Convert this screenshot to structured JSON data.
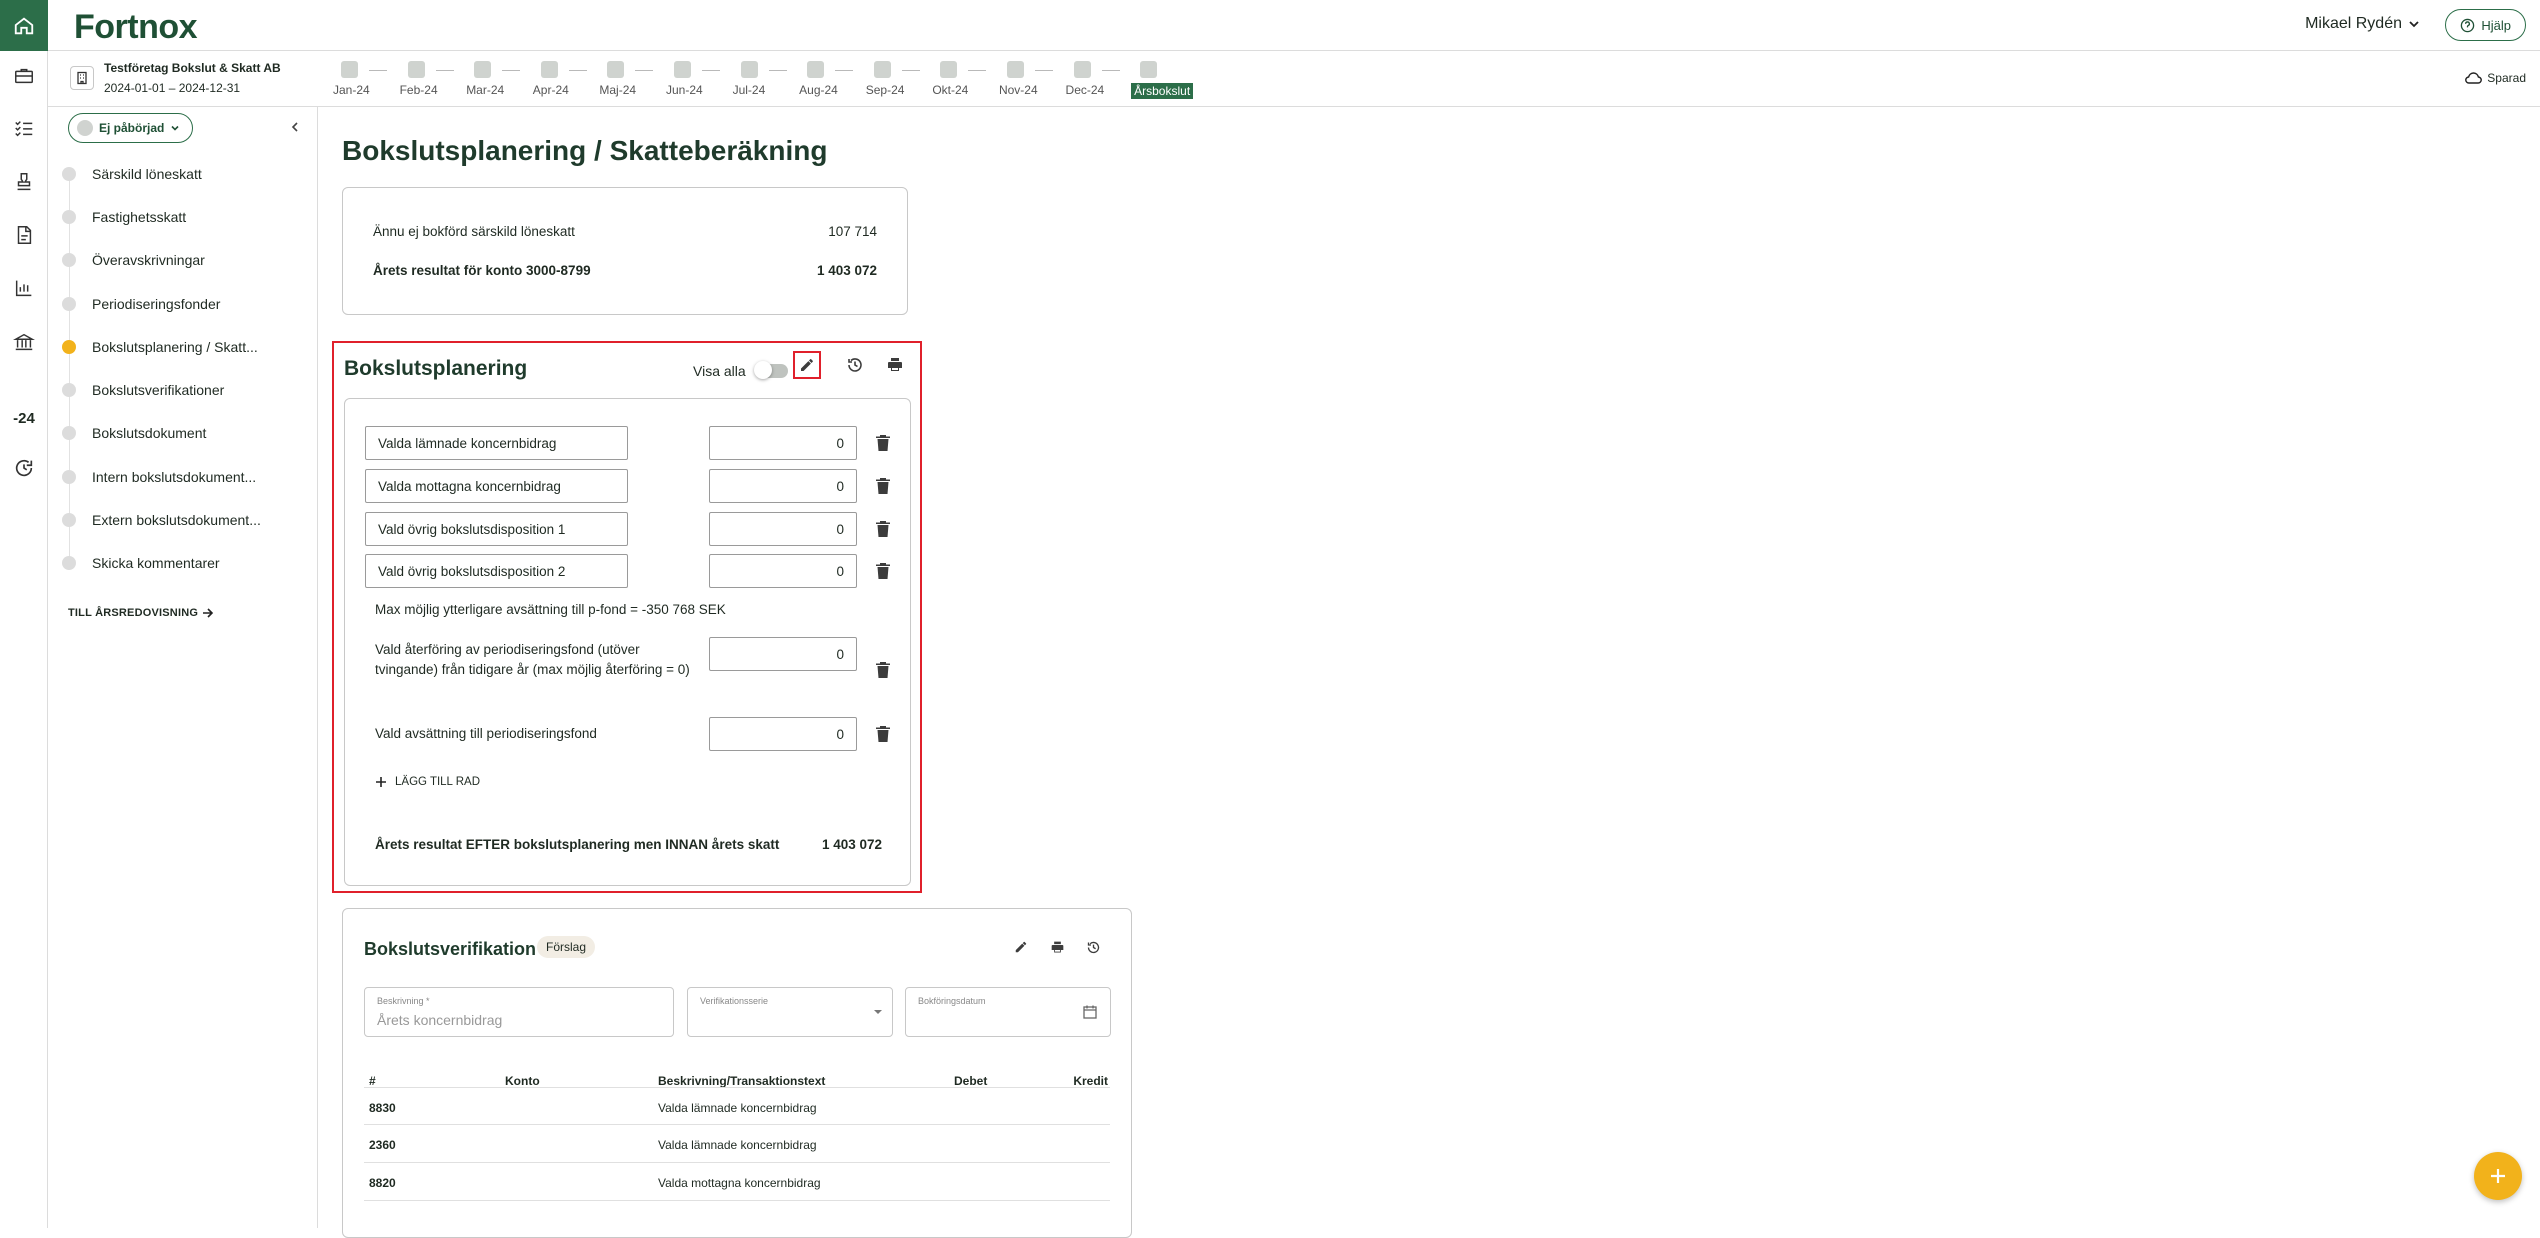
{
  "brand": {
    "logo": "Fortnox",
    "accent": "#2c6e49",
    "highlight": "#e0202b",
    "active_dot": "#f2b21b"
  },
  "rail": {
    "items": [
      "home-icon",
      "briefcase-icon",
      "checklist-icon",
      "stamp-icon",
      "document-icon",
      "chart-icon",
      "bank-icon",
      "-24",
      "refresh-icon"
    ]
  },
  "header": {
    "user": "Mikael Rydén",
    "help": "Hjälp"
  },
  "subheader": {
    "company_name": "Testföretag Bokslut & Skatt AB",
    "company_period": "2024-01-01 – 2024-12-31",
    "months": [
      "Jan-24",
      "Feb-24",
      "Mar-24",
      "Apr-24",
      "Maj-24",
      "Jun-24",
      "Jul-24",
      "Aug-24",
      "Sep-24",
      "Okt-24",
      "Nov-24",
      "Dec-24",
      "Årsbokslut"
    ],
    "saved": "Sparad"
  },
  "sidebar": {
    "status": "Ej påbörjad",
    "steps": [
      "Särskild löneskatt",
      "Fastighetsskatt",
      "Överavskrivningar",
      "Periodiseringsfonder",
      "Bokslutsplanering / Skatt...",
      "Bokslutsverifikationer",
      "Bokslutsdokument",
      "Intern bokslutsdokument...",
      "Extern bokslutsdokument...",
      "Skicka kommentarer"
    ],
    "active_step": "Bokslutsplanering / Skatt...",
    "link": "TILL ÅRSREDOVISNING"
  },
  "main": {
    "title": "Bokslutsplanering / Skatteberäkning",
    "summary": [
      {
        "label": "Ännu ej bokförd särskild löneskatt",
        "value": "107 714"
      },
      {
        "label": "Årets resultat för konto 3000-8799",
        "value": "1 403 072"
      }
    ]
  },
  "planning": {
    "title": "Bokslutsplanering",
    "show_all": "Visa alla",
    "rows": [
      {
        "label": "Valda lämnade koncernbidrag",
        "value": "0"
      },
      {
        "label": "Valda mottagna koncernbidrag",
        "value": "0"
      },
      {
        "label": "Vald övrig bokslutsdisposition 1",
        "value": "0"
      },
      {
        "label": "Vald övrig bokslutsdisposition 2",
        "value": "0"
      }
    ],
    "max_text": "Max möjlig ytterligare avsättning till p-fond = -350 768 SEK",
    "reversal_label": "Vald återföring av periodiseringsfond (utöver tvingande) från tidigare år (max möjlig återföring = 0)",
    "reversal_value": "0",
    "allocation_label": "Vald avsättning till periodiseringsfond",
    "allocation_value": "0",
    "add_row": "LÄGG TILL RAD",
    "total_label": "Årets resultat EFTER bokslutsplanering men INNAN årets skatt",
    "total_value": "1 403 072"
  },
  "verification": {
    "title": "Bokslutsverifikation",
    "badge": "Förslag",
    "fields": [
      {
        "label": "Beskrivning *",
        "value": "Årets koncernbidrag"
      },
      {
        "label": "Verifikationsserie",
        "value": ""
      },
      {
        "label": "Bokföringsdatum",
        "value": ""
      }
    ],
    "columns": [
      "#",
      "Konto",
      "Beskrivning/Transaktionstext",
      "Debet",
      "Kredit"
    ],
    "rows": [
      {
        "nr": "8830",
        "konto": "",
        "text": "Valda lämnade koncernbidrag",
        "debet": "",
        "kredit": ""
      },
      {
        "nr": "2360",
        "konto": "",
        "text": "Valda lämnade koncernbidrag",
        "debet": "",
        "kredit": ""
      },
      {
        "nr": "8820",
        "konto": "",
        "text": "Valda mottagna koncernbidrag",
        "debet": "",
        "kredit": ""
      }
    ]
  }
}
